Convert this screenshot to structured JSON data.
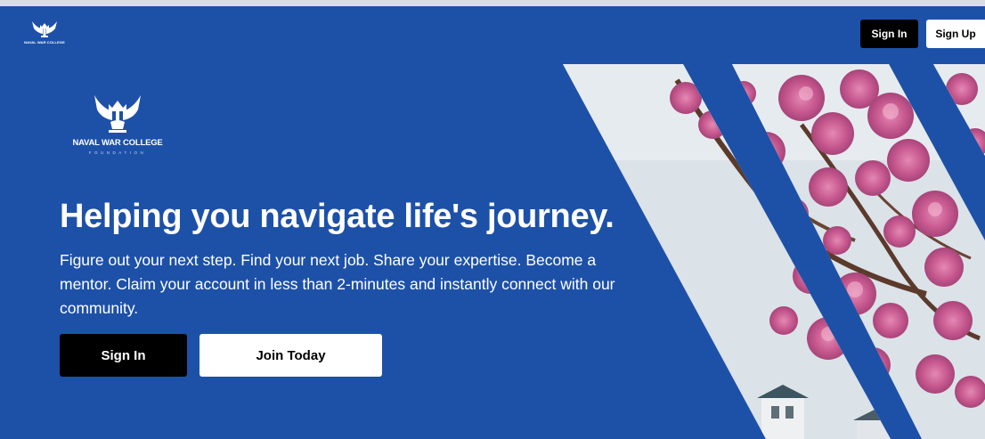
{
  "nav": {
    "logo_text": "NAVAL WAR COLLEGE",
    "signin_label": "Sign In",
    "signup_label": "Sign Up"
  },
  "hero": {
    "logo_name": "NAVAL WAR COLLEGE",
    "logo_sub": "FOUNDATION",
    "headline": "Helping you navigate life's journey.",
    "subtext": "Figure out your next step. Find your next job. Share your expertise. Become a mentor. Claim your account in less than 2-minutes and instantly connect with our community.",
    "signin_label": "Sign In",
    "join_label": "Join Today"
  },
  "colors": {
    "brand_blue": "#1d51a8",
    "button_dark": "#000000",
    "button_light": "#ffffff"
  },
  "icons": {
    "logo": "eagle-trident-emblem-icon"
  }
}
